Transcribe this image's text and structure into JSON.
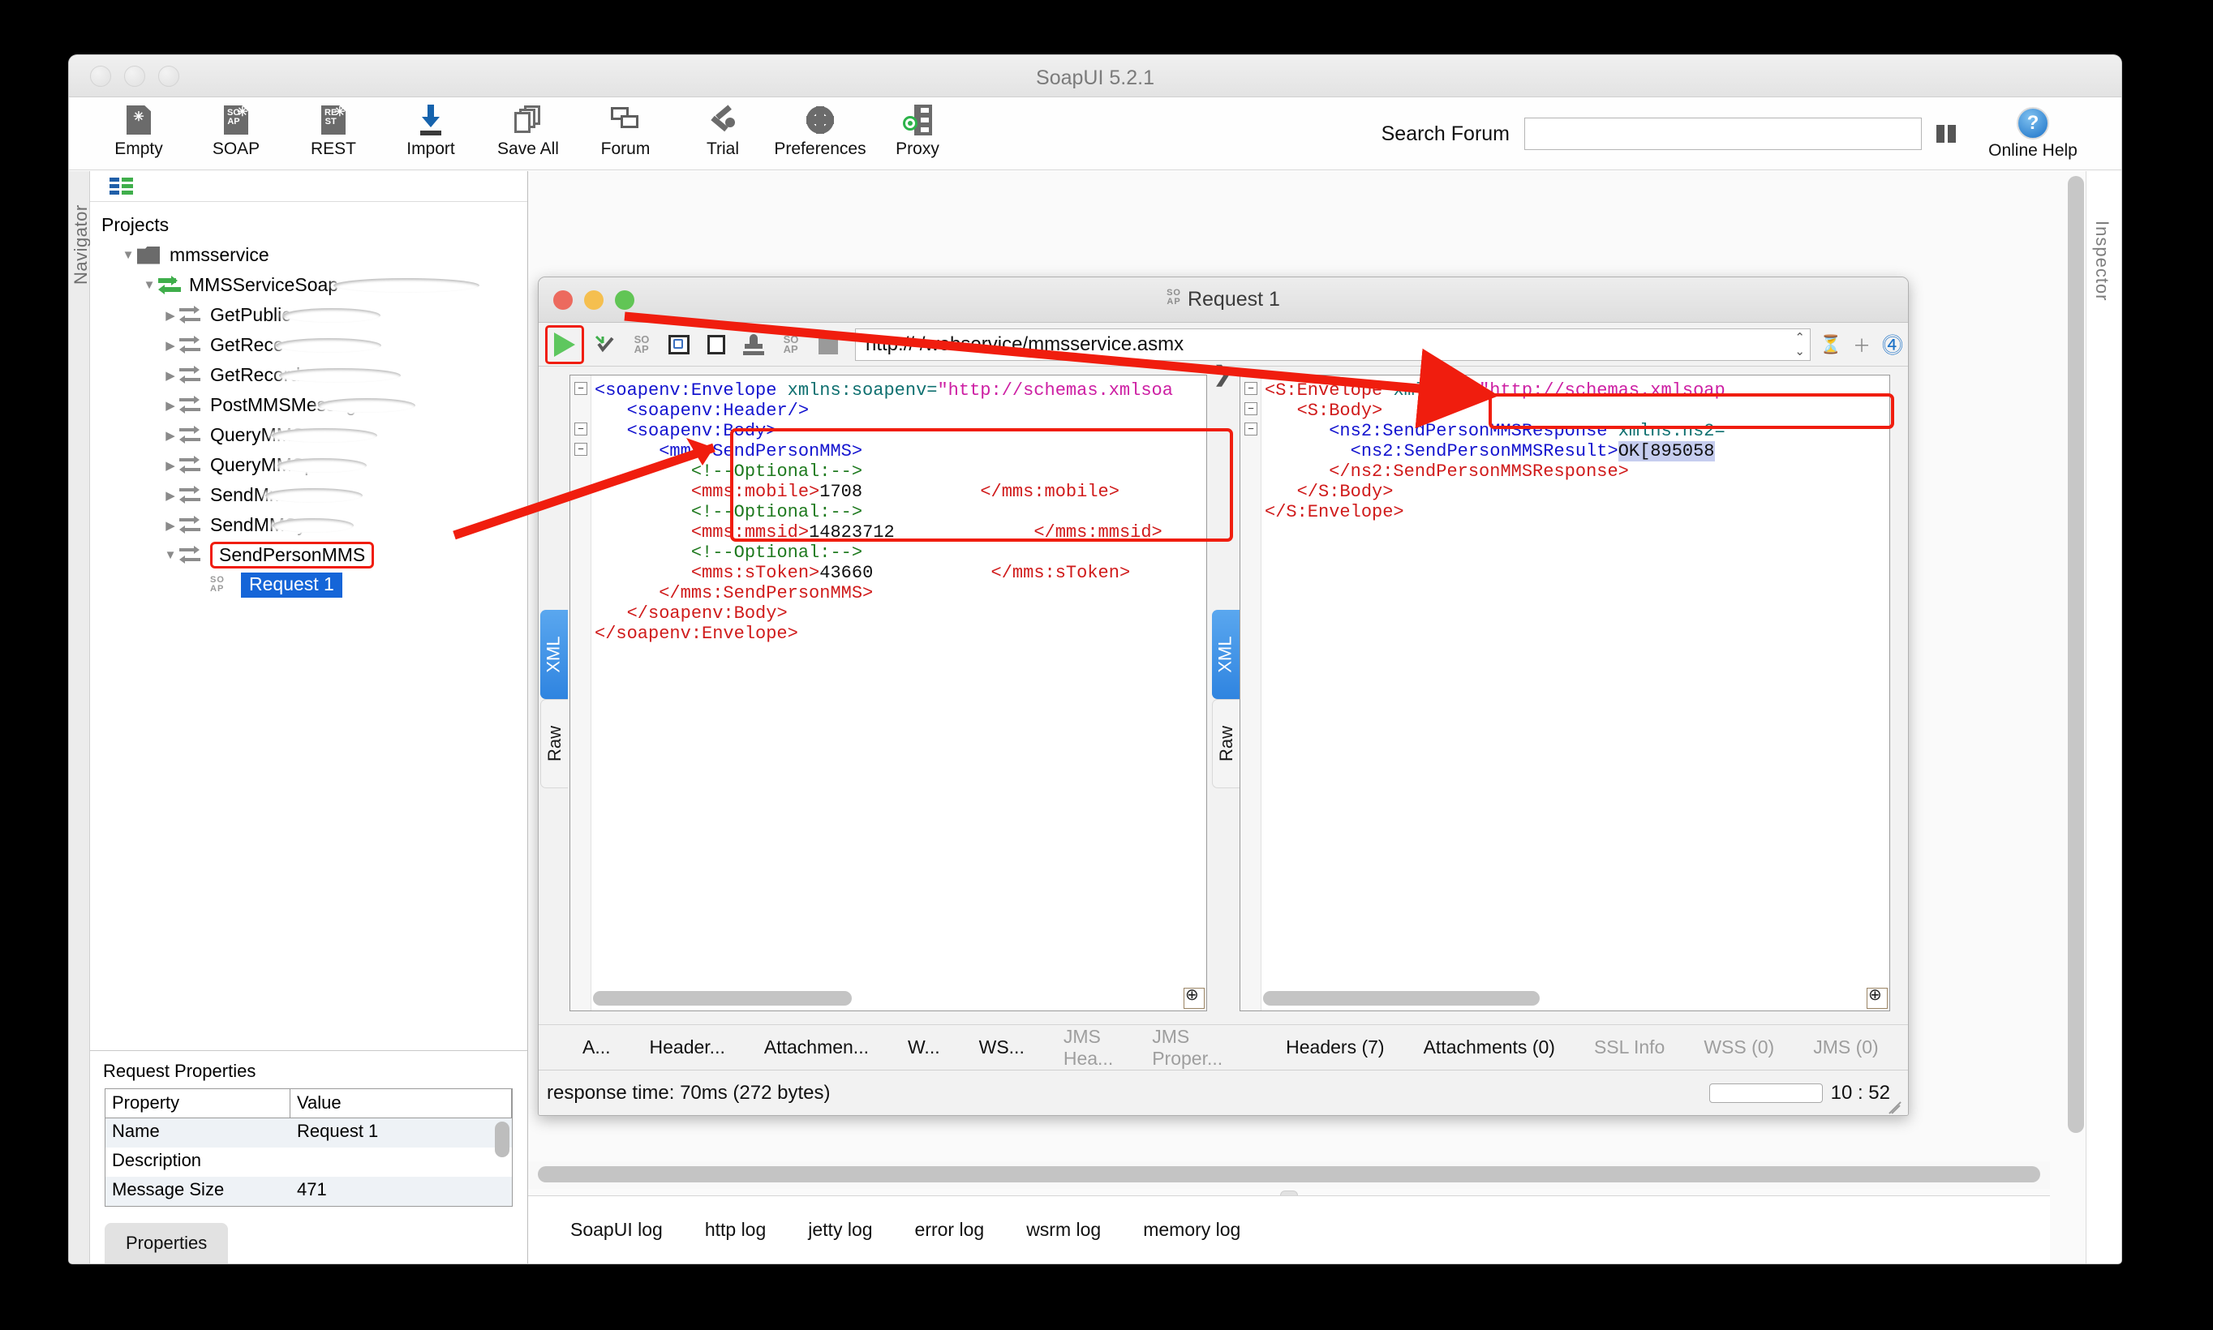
{
  "app": {
    "title": "SoapUI 5.2.1"
  },
  "toolbar": {
    "items": [
      {
        "label": "Empty",
        "icon": "empty-document-icon"
      },
      {
        "label": "SOAP",
        "icon": "soap-document-icon"
      },
      {
        "label": "REST",
        "icon": "rest-document-icon"
      },
      {
        "label": "Import",
        "icon": "import-arrow-icon"
      },
      {
        "label": "Save All",
        "icon": "save-all-stack-icon"
      },
      {
        "label": "Forum",
        "icon": "forum-bubble-icon"
      },
      {
        "label": "Trial",
        "icon": "trial-wrench-icon"
      },
      {
        "label": "Preferences",
        "icon": "gear-icon"
      },
      {
        "label": "Proxy",
        "icon": "proxy-server-icon"
      }
    ],
    "search_label": "Search Forum",
    "search_value": "",
    "search_placeholder": "",
    "binoculars_icon": "binoculars-icon",
    "help_label": "Online Help",
    "help_icon": "help-question-icon"
  },
  "navigator": {
    "strip_label": "Navigator",
    "list_icon": "properties-list-icon",
    "root_label": "Projects",
    "tree": [
      {
        "label": "mmsservice",
        "indent": 1,
        "twist": "down",
        "icon": "folder-icon",
        "smudged": false
      },
      {
        "label": "MMSServiceSoap",
        "indent": 2,
        "twist": "down",
        "icon": "interface-icon",
        "smudged": true
      },
      {
        "label": "GetPublic",
        "indent": 3,
        "twist": "right",
        "icon": "operation-icon",
        "smudged": true
      },
      {
        "label": "GetReco",
        "indent": 3,
        "twist": "right",
        "icon": "operation-icon",
        "smudged": true
      },
      {
        "label": "GetRecord",
        "indent": 3,
        "twist": "right",
        "icon": "operation-icon",
        "smudged": true
      },
      {
        "label": "PostMMSMessage",
        "indent": 3,
        "twist": "right",
        "icon": "operation-icon",
        "smudged": true
      },
      {
        "label": "QueryMMS",
        "indent": 3,
        "twist": "right",
        "icon": "operation-icon",
        "smudged": true
      },
      {
        "label": "QueryMMSp",
        "indent": 3,
        "twist": "right",
        "icon": "operation-icon",
        "smudged": true
      },
      {
        "label": "SendMm",
        "indent": 3,
        "twist": "right",
        "icon": "operation-icon",
        "smudged": true
      },
      {
        "label": "SendMMSy",
        "indent": 3,
        "twist": "right",
        "icon": "operation-icon",
        "smudged": true
      }
    ],
    "selected_operation": "SendPersonMMS",
    "selected_request": "Request 1"
  },
  "request_properties": {
    "title": "Request Properties",
    "columns": [
      "Property",
      "Value"
    ],
    "rows": [
      {
        "property": "Name",
        "value": "Request 1"
      },
      {
        "property": "Description",
        "value": ""
      },
      {
        "property": "Message Size",
        "value": "471"
      }
    ],
    "button_label": "Properties"
  },
  "request_window": {
    "title": "Request 1",
    "soap_badge": "SOAP",
    "url": "http://                /webservice/mmsservice.asmx",
    "url_visible_prefix": "http://",
    "url_visible_suffix": "/webservice/mmsservice.asmx",
    "toolbar_icons": [
      "run-play-icon",
      "validate-check-icon",
      "soap-create-icon",
      "clone-icon",
      "outline-icon",
      "auth-stamp-icon",
      "soap-ws-icon",
      "stop-icon"
    ],
    "editor_tabs": [
      "XML",
      "Raw"
    ],
    "editor_tab_selected": "XML",
    "request_xml_lines": [
      "<soapenv:Envelope xmlns:soapenv=\"http://schemas.xmlsoa",
      "   <soapenv:Header/>",
      "   <soapenv:Body>",
      "      <mms:SendPersonMMS>",
      "         <!--Optional:-->",
      "         <mms:mobile>1708...</mms:mobile>",
      "         <!--Optional:-->",
      "         <mms:mmsid>14823712...</mms:mmsid>",
      "         <!--Optional:-->",
      "         <mms:sToken>43660...</mms:sToken>",
      "      </mms:SendPersonMMS>",
      "   </soapenv:Body>",
      "</soapenv:Envelope>"
    ],
    "request_values": {
      "mobile": "1708",
      "mmsid": "14823712",
      "stoken": "43660"
    },
    "response_xml_lines": [
      "<S:Envelope xmlns:S=\"http://schemas.xmlsoap",
      "   <S:Body>",
      "      <ns2:SendPersonMMSResponse xmlns:ns2=",
      "        <ns2:SendPersonMMSResult>OK[895058",
      "      </ns2:SendPersonMMSResponse>",
      "   </S:Body>",
      "</S:Envelope>"
    ],
    "response_result_value": "OK[895058",
    "request_tabs": [
      "A...",
      "Header...",
      "Attachmen...",
      "W...",
      "WS...",
      "JMS Hea...",
      "JMS Proper..."
    ],
    "request_tabs_dim": [
      "JMS Hea...",
      "JMS Proper..."
    ],
    "response_tabs": [
      "Headers (7)",
      "Attachments (0)",
      "SSL Info",
      "WSS (0)",
      "JMS (0)"
    ],
    "response_tabs_dim": [
      "SSL Info",
      "WSS (0)",
      "JMS (0)"
    ],
    "status_text": "response time: 70ms (272 bytes)",
    "clock": "10 : 52"
  },
  "log_tabs": [
    "SoapUI log",
    "http log",
    "jetty log",
    "error log",
    "wsrm log",
    "memory log"
  ],
  "inspector": {
    "label": "Inspector"
  },
  "colors": {
    "accent_blue": "#1565d8",
    "annotation_red": "#f01d0e",
    "green_run": "#5ec75e",
    "selection_blue": "#c6cdef"
  }
}
